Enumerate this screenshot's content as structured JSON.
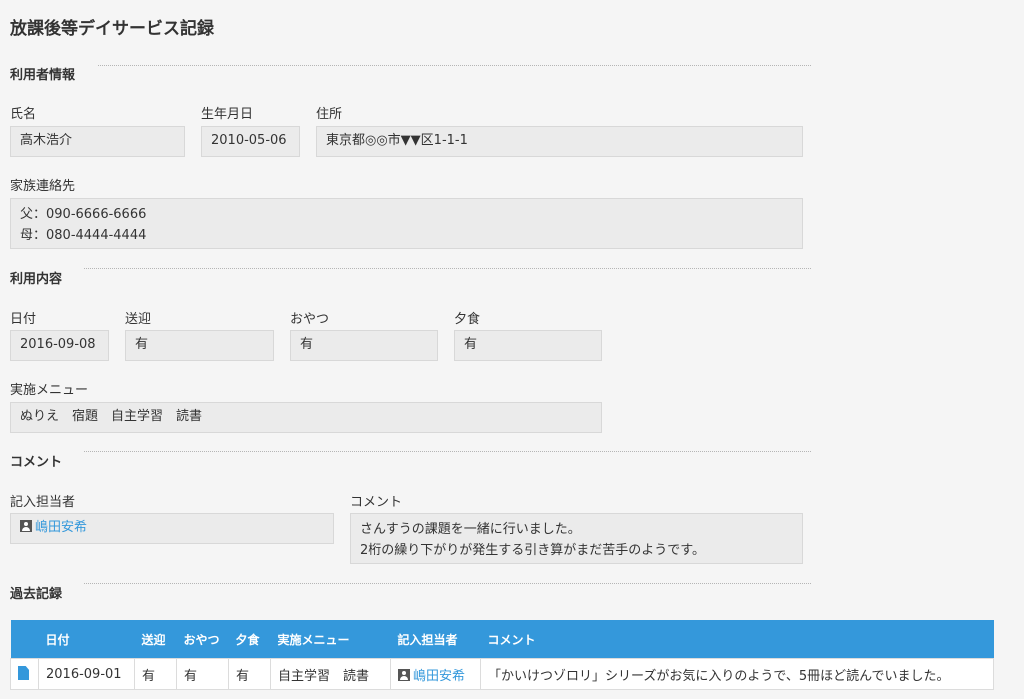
{
  "page": {
    "title": "放課後等デイサービス記録"
  },
  "sections": {
    "user_info": "利用者情報",
    "usage": "利用内容",
    "comment": "コメント",
    "history": "過去記録"
  },
  "user_info": {
    "name_label": "氏名",
    "name": "高木浩介",
    "birth_label": "生年月日",
    "birth": "2010-05-06",
    "address_label": "住所",
    "address": "東京都◎◎市▼▼区1-1-1",
    "family_label": "家族連絡先",
    "family": [
      "父：090-6666-6666",
      "母：080-4444-4444"
    ]
  },
  "usage": {
    "date_label": "日付",
    "date": "2016-09-08",
    "transport_label": "送迎",
    "transport": "有",
    "snack_label": "おやつ",
    "snack": "有",
    "dinner_label": "夕食",
    "dinner": "有",
    "menu_label": "実施メニュー",
    "menu": "ぬりえ　宿題　自主学習　読書"
  },
  "comment": {
    "author_label": "記入担当者",
    "author": "嶋田安希",
    "comment_label": "コメント",
    "lines": [
      "さんすうの課題を一緒に行いました。",
      "2桁の繰り下がりが発生する引き算がまだ苦手のようです。"
    ]
  },
  "history": {
    "headers": [
      "",
      "日付",
      "送迎",
      "おやつ",
      "夕食",
      "実施メニュー",
      "記入担当者",
      "コメント"
    ],
    "rows": [
      {
        "date": "2016-09-01",
        "transport": "有",
        "snack": "有",
        "dinner": "有",
        "menu": "自主学習　読書",
        "author": "嶋田安希",
        "comment": "「かいけつゾロリ」シリーズがお気に入りのようで、5冊ほど読んでいました。"
      }
    ]
  }
}
